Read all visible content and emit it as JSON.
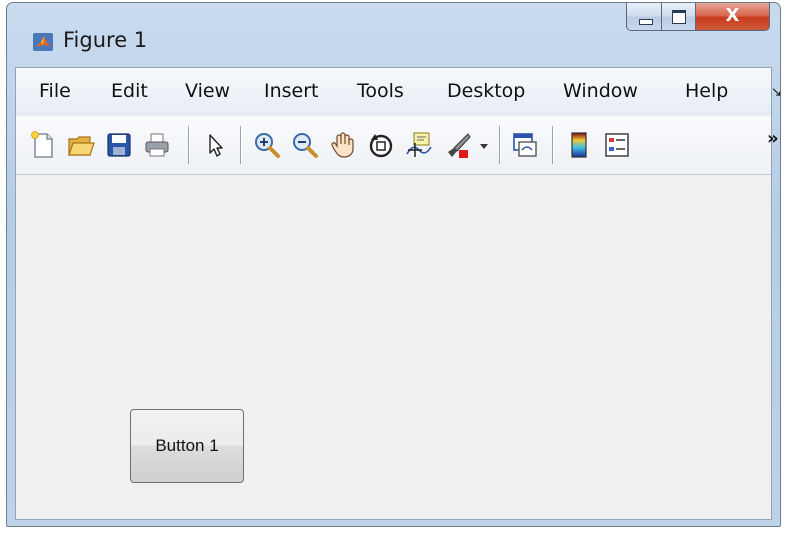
{
  "window": {
    "title": "Figure 1",
    "app_icon": "matlab-icon",
    "controls": {
      "minimize_icon": "minimize-icon",
      "maximize_icon": "maximize-icon",
      "close_glyph": "X"
    }
  },
  "menubar": {
    "items": [
      {
        "label": "File"
      },
      {
        "label": "Edit"
      },
      {
        "label": "View"
      },
      {
        "label": "Insert"
      },
      {
        "label": "Tools"
      },
      {
        "label": "Desktop"
      },
      {
        "label": "Window"
      },
      {
        "label": "Help"
      }
    ],
    "overflow_glyph": "↘"
  },
  "toolbar": {
    "items": [
      {
        "icon": "new-figure-icon"
      },
      {
        "icon": "open-file-icon"
      },
      {
        "icon": "save-icon"
      },
      {
        "icon": "print-icon"
      },
      {
        "icon": "pointer-icon"
      },
      {
        "icon": "zoom-in-icon"
      },
      {
        "icon": "zoom-out-icon"
      },
      {
        "icon": "pan-hand-icon"
      },
      {
        "icon": "rotate-3d-icon"
      },
      {
        "icon": "data-cursor-icon"
      },
      {
        "icon": "brush-icon"
      },
      {
        "icon": "link-plot-icon"
      },
      {
        "icon": "colorbar-icon"
      },
      {
        "icon": "legend-icon"
      }
    ],
    "overflow_glyph": "»"
  },
  "canvas": {
    "button": {
      "label": "Button 1"
    }
  }
}
